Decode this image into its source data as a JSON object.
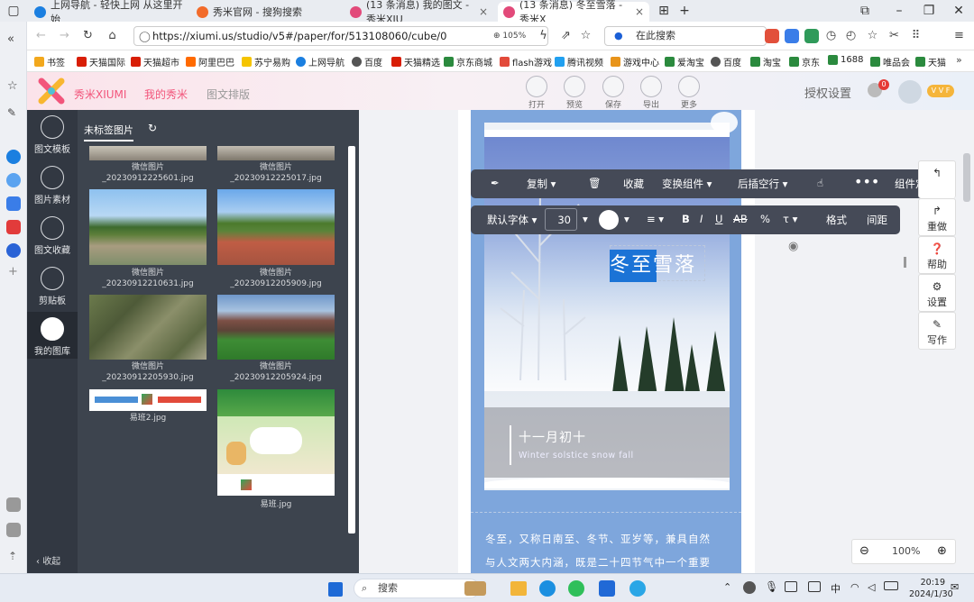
{
  "browser": {
    "tabs": [
      {
        "title": "上网导航 - 轻快上网 从这里开始",
        "color": "#1b7fe0"
      },
      {
        "title": "秀米官网 - 搜狗搜索",
        "color": "#f26b2a"
      },
      {
        "title": "(13 条消息) 我的图文 - 秀米XIU",
        "color": "#e24a7a"
      },
      {
        "title": "(13 条消息) 冬至雪落 - 秀米X",
        "color": "#e24a7a"
      }
    ],
    "url": "https://xiumi.us/studio/v5#/paper/for/513108060/cube/0",
    "zoom": "105%",
    "search_placeholder": "在此搜索",
    "bookmarks": [
      {
        "label": "书签",
        "color": "#f2a81d"
      },
      {
        "label": "天猫国际",
        "color": "#d81e06"
      },
      {
        "label": "天猫超市",
        "color": "#d81e06"
      },
      {
        "label": "阿里巴巴",
        "color": "#ff6a00"
      },
      {
        "label": "苏宁易购",
        "color": "#f5c400"
      },
      {
        "label": "上网导航",
        "color": "#1b7fe0"
      },
      {
        "label": "百度",
        "color": "#555555"
      },
      {
        "label": "天猫精选",
        "color": "#d81e06"
      },
      {
        "label": "京东商城",
        "color": "#2b8a3e"
      },
      {
        "label": "flash游戏",
        "color": "#e24a3a"
      },
      {
        "label": "腾讯视频",
        "color": "#21a0f0"
      },
      {
        "label": "游戏中心",
        "color": "#e8941a"
      },
      {
        "label": "爱淘宝",
        "color": "#2b8a3e"
      },
      {
        "label": "百度",
        "color": "#555555"
      },
      {
        "label": "淘宝",
        "color": "#2b8a3e"
      },
      {
        "label": "京东",
        "color": "#2b8a3e"
      },
      {
        "label": "1688",
        "color": "#2b8a3e"
      },
      {
        "label": "唯品会",
        "color": "#2b8a3e"
      },
      {
        "label": "天猫",
        "color": "#2b8a3e"
      }
    ]
  },
  "app": {
    "brand": "秀米XIUMI",
    "nav": [
      "我的秀米",
      "图文排版"
    ],
    "actions": [
      "打开",
      "预览",
      "保存",
      "导出",
      "更多"
    ],
    "auth": "授权设置",
    "notification_count": "0",
    "vip_badge": "V V F",
    "sidebar": [
      {
        "label": "图文模板"
      },
      {
        "label": "图片素材"
      },
      {
        "label": "图文收藏"
      },
      {
        "label": "剪贴板"
      },
      {
        "label": "我的图库"
      }
    ],
    "collapse": "收起",
    "gallery_tab": "未标签图片",
    "images": [
      {
        "name": "微信图片_20230912225601.jpg"
      },
      {
        "name": "微信图片_20230912225017.jpg"
      },
      {
        "name": "微信图片_20230912210631.jpg"
      },
      {
        "name": "微信图片_20230912205909.jpg"
      },
      {
        "name": "微信图片_20230912205930.jpg"
      },
      {
        "name": "微信图片_20230912205924.jpg"
      },
      {
        "name": "易班2.jpg"
      },
      {
        "name": "易班.jpg"
      }
    ],
    "toolbar1": [
      "复制",
      "收藏",
      "变换组件",
      "后插空行",
      "组件定位"
    ],
    "toolbar2": {
      "font": "默认字体",
      "size": "30",
      "bold": "B",
      "italic": "I",
      "underline": "U",
      "strike": "AB",
      "format": "格式",
      "spacing": "间距"
    },
    "right_tools": [
      {
        "label": "重做"
      },
      {
        "label": "帮助"
      },
      {
        "label": "设置"
      },
      {
        "label": "写作"
      }
    ],
    "zoom_level": "100%",
    "article": {
      "title": "冬至雪落",
      "date": "十一月初十",
      "subtitle": "Winter solstice snow fall",
      "body": [
        "冬至，又称日南至、冬节、亚岁等，兼具自然",
        "与人文两大内涵，既是二十四节气中一个重要"
      ]
    }
  },
  "taskbar": {
    "search": "搜索",
    "ime": "中",
    "time": "20:19",
    "date": "2024/1/30"
  }
}
